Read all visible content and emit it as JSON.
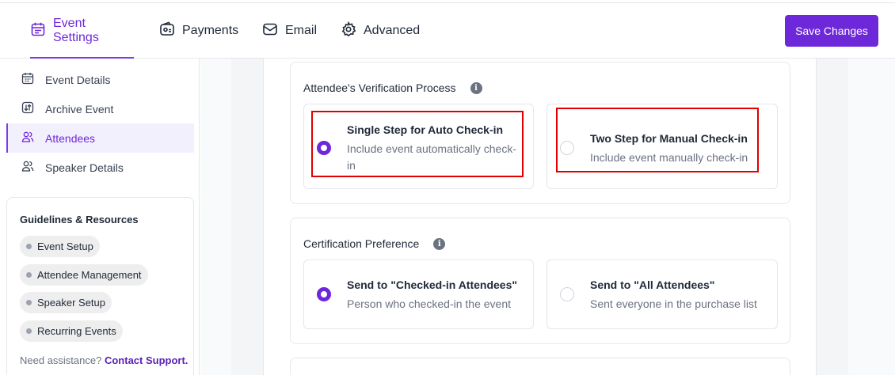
{
  "header": {
    "tabs": [
      {
        "label": "Event Settings",
        "icon": "calendar-icon",
        "active": true
      },
      {
        "label": "Payments",
        "icon": "wallet-icon",
        "active": false
      },
      {
        "label": "Email",
        "icon": "envelope-icon",
        "active": false
      },
      {
        "label": "Advanced",
        "icon": "gear-icon",
        "active": false
      }
    ],
    "save_label": "Save Changes"
  },
  "sidebar": {
    "items": [
      {
        "label": "Event Details",
        "icon": "calendar-icon"
      },
      {
        "label": "Archive Event",
        "icon": "archive-icon"
      },
      {
        "label": "Attendees",
        "icon": "users-icon",
        "active": true
      },
      {
        "label": "Speaker Details",
        "icon": "users-icon"
      }
    ],
    "guidelines": {
      "title": "Guidelines & Resources",
      "links": [
        "Event Setup",
        "Attendee Management",
        "Speaker Setup",
        "Recurring Events"
      ],
      "assist_text": "Need assistance?",
      "assist_link": "Contact Support."
    }
  },
  "verification": {
    "title": "Attendee's Verification Process",
    "options": [
      {
        "title": "Single Step for Auto Check-in",
        "desc": "Include event automatically check-in",
        "selected": true
      },
      {
        "title": "Two Step for Manual Check-in",
        "desc": "Include event manually check-in",
        "selected": false
      }
    ]
  },
  "certification": {
    "title": "Certification Preference",
    "options": [
      {
        "title": "Send to \"Checked-in Attendees\"",
        "desc": "Person who checked-in the event",
        "selected": true
      },
      {
        "title": "Send to \"All Attendees\"",
        "desc": "Sent everyone in the purchase list",
        "selected": false
      }
    ]
  },
  "colors": {
    "accent": "#6d28d9",
    "highlight": "#e00000"
  }
}
